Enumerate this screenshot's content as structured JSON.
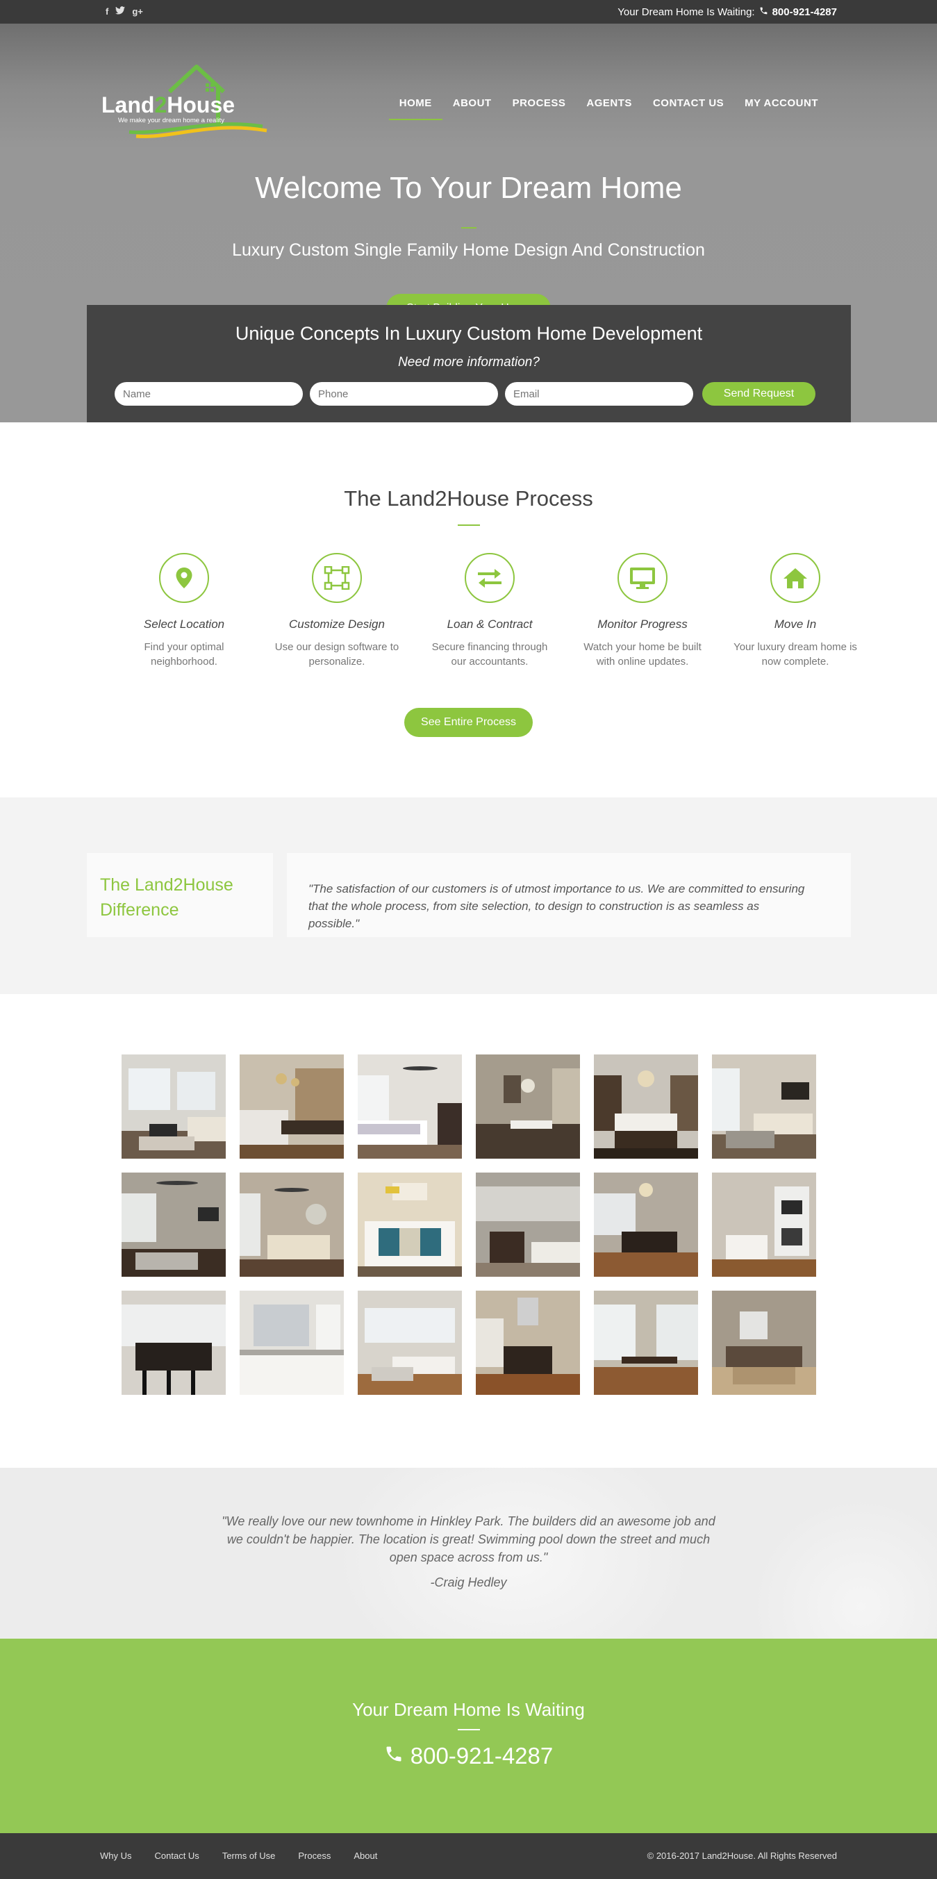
{
  "topbar": {
    "social": [
      {
        "icon": "facebook-icon",
        "glyph": "f"
      },
      {
        "icon": "twitter-icon",
        "glyph": "t"
      },
      {
        "icon": "google-plus-icon",
        "glyph": "g+"
      }
    ],
    "waiting_text": "Your Dream Home Is Waiting:",
    "phone": "800-921-4287"
  },
  "logo": {
    "text_land": "Land",
    "text_2": "2",
    "text_house": "House",
    "tagline": "We make your dream home a reality"
  },
  "nav": {
    "items": [
      {
        "label": "HOME",
        "active": true
      },
      {
        "label": "ABOUT",
        "active": false
      },
      {
        "label": "PROCESS",
        "active": false
      },
      {
        "label": "AGENTS",
        "active": false
      },
      {
        "label": "CONTACT US",
        "active": false
      },
      {
        "label": "MY ACCOUNT",
        "active": false
      }
    ]
  },
  "hero": {
    "title": "Welcome To Your Dream Home",
    "subtitle": "Luxury Custom Single Family Home Design And Construction",
    "cta": "Start Building Your Home"
  },
  "info": {
    "title": "Unique Concepts In Luxury Custom Home Development",
    "question": "Need more information?",
    "name_placeholder": "Name",
    "phone_placeholder": "Phone",
    "email_placeholder": "Email",
    "send": "Send Request"
  },
  "process": {
    "title": "The Land2House Process",
    "steps": [
      {
        "icon": "map-pin-icon",
        "title": "Select Location",
        "desc": "Find your optimal neighborhood."
      },
      {
        "icon": "design-vector-icon",
        "title": "Customize Design",
        "desc": "Use our design software to personalize."
      },
      {
        "icon": "exchange-arrows-icon",
        "title": "Loan & Contract",
        "desc": "Secure financing through our accountants."
      },
      {
        "icon": "monitor-icon",
        "title": "Monitor Progress",
        "desc": "Watch your home be built with online updates."
      },
      {
        "icon": "home-icon",
        "title": "Move In",
        "desc": "Your luxury dream home is now complete."
      }
    ],
    "cta": "See Entire Process"
  },
  "difference": {
    "title": "The Land2House Difference",
    "quote": "\"The satisfaction of our customers is of utmost importance to us. We are committed to ensuring that the whole process, from site selection, to design to construction is as seamless as possible.\""
  },
  "testimonial": {
    "quote": "\"We really love our new townhome in Hinkley Park. The builders did an awesome job and we couldn't be happier. The location is great! Swimming pool down the street and much open space across from us.\"",
    "author": "-Craig Hedley"
  },
  "cta": {
    "title": "Your Dream Home Is Waiting",
    "phone": "800-921-4287"
  },
  "footer": {
    "links": [
      "Why Us",
      "Contact Us",
      "Terms of Use",
      "Process",
      "About"
    ],
    "copyright": "© 2016-2017 Land2House. All Rights Reserved"
  },
  "colors": {
    "accent_green": "#8dc63f",
    "cta_green": "#93c855",
    "dark_bar": "#3a3a3a",
    "info_box": "#444444"
  }
}
